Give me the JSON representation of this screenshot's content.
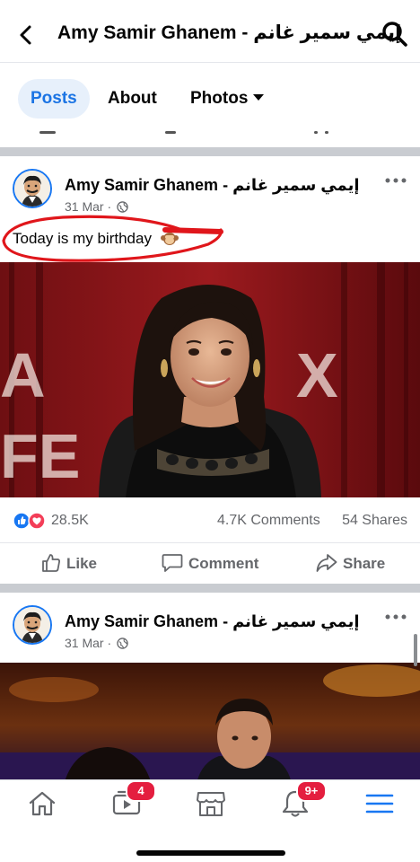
{
  "header": {
    "page_name": "Amy Samir Ghanem - إيمي سمير غانم",
    "back_icon": "chevron-left-icon",
    "search_icon": "search-icon"
  },
  "tabs": [
    {
      "label": "Posts",
      "active": true
    },
    {
      "label": "About",
      "active": false
    },
    {
      "label": "Photos",
      "active": false
    }
  ],
  "posts": [
    {
      "author": "Amy Samir Ghanem - إيمي سمير غانم",
      "date": "31 Mar",
      "separator": "·",
      "text": "Today is my birthday",
      "reactions_count": "28.5K",
      "comments_count": "4.7K Comments",
      "shares_count": "54 Shares"
    },
    {
      "author": "Amy Samir Ghanem - إيمي سمير غانم",
      "date": "31 Mar",
      "separator": "·"
    }
  ],
  "actions": {
    "like": "Like",
    "comment": "Comment",
    "share": "Share"
  },
  "bottom_nav": {
    "watch_badge": "4",
    "notifications_badge": "9+"
  },
  "colors": {
    "accent": "#1877f2",
    "badge": "#e41e3f",
    "highlight_marker": "#e0161b",
    "secondary_text": "#65676b"
  }
}
